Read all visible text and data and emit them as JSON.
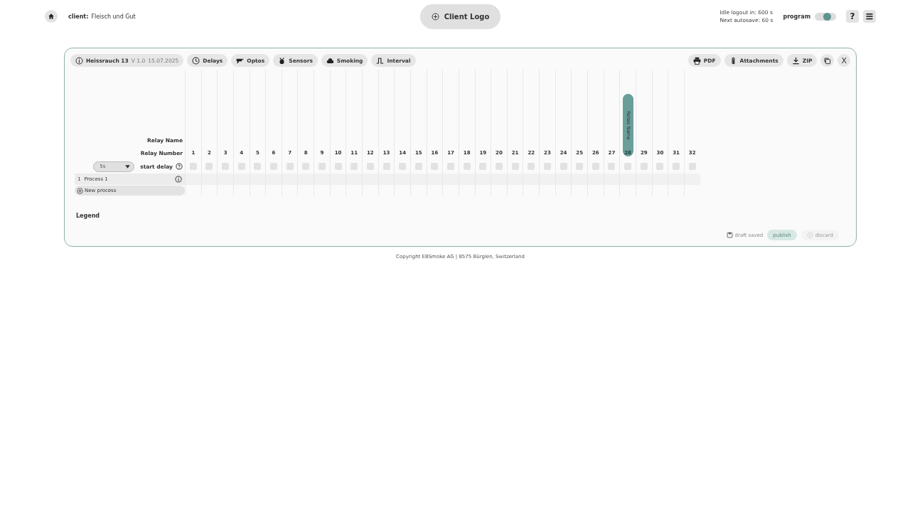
{
  "header": {
    "client_label": "client:",
    "client_name": "Fleisch und Gut",
    "logo_button": "Client Logo",
    "idle_logout": "Idle logout in: 600 s",
    "next_autosave": "Next autosave: 60 s",
    "program_label": "program",
    "program_on": true,
    "help": "?"
  },
  "toolbar": {
    "program_name": "Heissrauch 13",
    "version": "V 1.0",
    "date": "15.07.2025",
    "tabs": [
      {
        "kind": "delays",
        "label": "Delays"
      },
      {
        "kind": "optos",
        "label": "Optos"
      },
      {
        "kind": "sensors",
        "label": "Sensors"
      },
      {
        "kind": "smoking",
        "label": "Smoking"
      },
      {
        "kind": "interval",
        "label": "Interval"
      }
    ],
    "actions": [
      {
        "kind": "pdf",
        "label": "PDF"
      },
      {
        "kind": "attachments",
        "label": "Attachments"
      },
      {
        "kind": "zip",
        "label": "ZIP"
      }
    ],
    "close": "X"
  },
  "grid": {
    "relay_name_label": "Relay Name",
    "relay_number_label": "Relay Number",
    "start_delay_select": "5s",
    "start_delay_label": "start delay",
    "relays": [
      {
        "number": "1",
        "selected": false,
        "checked": false
      },
      {
        "number": "2",
        "selected": false,
        "checked": false
      },
      {
        "number": "3",
        "selected": false,
        "checked": false
      },
      {
        "number": "4",
        "selected": false,
        "checked": false
      },
      {
        "number": "5",
        "selected": false,
        "checked": false
      },
      {
        "number": "6",
        "selected": false,
        "checked": false
      },
      {
        "number": "7",
        "selected": false,
        "checked": false
      },
      {
        "number": "8",
        "selected": false,
        "checked": false
      },
      {
        "number": "9",
        "selected": false,
        "checked": false
      },
      {
        "number": "10",
        "selected": false,
        "checked": false
      },
      {
        "number": "11",
        "selected": false,
        "checked": false
      },
      {
        "number": "12",
        "selected": false,
        "checked": false
      },
      {
        "number": "13",
        "selected": false,
        "checked": false
      },
      {
        "number": "14",
        "selected": false,
        "checked": false
      },
      {
        "number": "15",
        "selected": false,
        "checked": false
      },
      {
        "number": "16",
        "selected": false,
        "checked": false
      },
      {
        "number": "17",
        "selected": false,
        "checked": false
      },
      {
        "number": "18",
        "selected": false,
        "checked": false
      },
      {
        "number": "19",
        "selected": false,
        "checked": false
      },
      {
        "number": "20",
        "selected": false,
        "checked": false
      },
      {
        "number": "21",
        "selected": false,
        "checked": false
      },
      {
        "number": "22",
        "selected": false,
        "checked": false
      },
      {
        "number": "23",
        "selected": false,
        "checked": false
      },
      {
        "number": "24",
        "selected": false,
        "checked": false
      },
      {
        "number": "25",
        "selected": false,
        "checked": false
      },
      {
        "number": "26",
        "selected": false,
        "checked": false
      },
      {
        "number": "27",
        "selected": false,
        "checked": false
      },
      {
        "number": "28",
        "selected": true,
        "checked": false,
        "name": "Relais Name"
      },
      {
        "number": "29",
        "selected": false,
        "checked": false
      },
      {
        "number": "30",
        "selected": false,
        "checked": false
      },
      {
        "number": "31",
        "selected": false,
        "checked": false
      },
      {
        "number": "32",
        "selected": false,
        "checked": false
      }
    ],
    "processes": [
      {
        "index": "1",
        "name": "Process 1"
      }
    ],
    "new_process": "New process"
  },
  "legend": "Legend",
  "footer_actions": {
    "draft_status": "draft saved",
    "publish": "publish",
    "publish_disabled": true,
    "discard": "discard",
    "discard_disabled": true
  },
  "copyright": "Copyright EBSmoke AG | 8575 Bürglen, Switzerland"
}
